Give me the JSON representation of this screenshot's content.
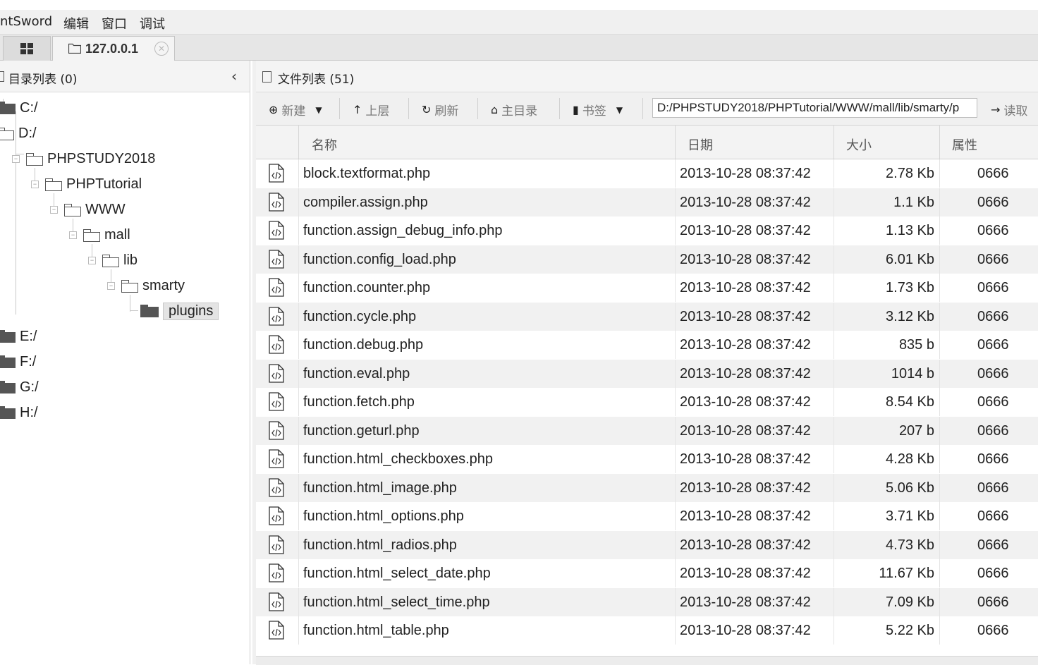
{
  "menubar": {
    "app": "ntSword",
    "edit": "编辑",
    "window": "窗口",
    "debug": "调试"
  },
  "tabs": {
    "host": "127.0.0.1"
  },
  "left": {
    "title": "目录列表 (0)",
    "tree": [
      {
        "label": "C:/"
      },
      {
        "label": "D:/"
      },
      {
        "label": "PHPSTUDY2018"
      },
      {
        "label": "PHPTutorial"
      },
      {
        "label": "WWW"
      },
      {
        "label": "mall"
      },
      {
        "label": "lib"
      },
      {
        "label": "smarty"
      },
      {
        "label": "plugins"
      },
      {
        "label": "E:/"
      },
      {
        "label": "F:/"
      },
      {
        "label": "G:/"
      },
      {
        "label": "H:/"
      }
    ]
  },
  "right": {
    "title": "文件列表 (51)",
    "toolbar": {
      "new": "新建",
      "up": "上层",
      "refresh": "刷新",
      "home": "主目录",
      "bookmark": "书签",
      "read": "读取"
    },
    "path": "D:/PHPSTUDY2018/PHPTutorial/WWW/mall/lib/smarty/p",
    "columns": {
      "name": "名称",
      "date": "日期",
      "size": "大小",
      "attr": "属性"
    },
    "files": [
      {
        "name": "block.textformat.php",
        "date": "2013-10-28 08:37:42",
        "size": "2.78 Kb",
        "attr": "0666"
      },
      {
        "name": "compiler.assign.php",
        "date": "2013-10-28 08:37:42",
        "size": "1.1 Kb",
        "attr": "0666"
      },
      {
        "name": "function.assign_debug_info.php",
        "date": "2013-10-28 08:37:42",
        "size": "1.13 Kb",
        "attr": "0666"
      },
      {
        "name": "function.config_load.php",
        "date": "2013-10-28 08:37:42",
        "size": "6.01 Kb",
        "attr": "0666"
      },
      {
        "name": "function.counter.php",
        "date": "2013-10-28 08:37:42",
        "size": "1.73 Kb",
        "attr": "0666"
      },
      {
        "name": "function.cycle.php",
        "date": "2013-10-28 08:37:42",
        "size": "3.12 Kb",
        "attr": "0666"
      },
      {
        "name": "function.debug.php",
        "date": "2013-10-28 08:37:42",
        "size": "835 b",
        "attr": "0666"
      },
      {
        "name": "function.eval.php",
        "date": "2013-10-28 08:37:42",
        "size": "1014 b",
        "attr": "0666"
      },
      {
        "name": "function.fetch.php",
        "date": "2013-10-28 08:37:42",
        "size": "8.54 Kb",
        "attr": "0666"
      },
      {
        "name": "function.geturl.php",
        "date": "2013-10-28 08:37:42",
        "size": "207 b",
        "attr": "0666"
      },
      {
        "name": "function.html_checkboxes.php",
        "date": "2013-10-28 08:37:42",
        "size": "4.28 Kb",
        "attr": "0666"
      },
      {
        "name": "function.html_image.php",
        "date": "2013-10-28 08:37:42",
        "size": "5.06 Kb",
        "attr": "0666"
      },
      {
        "name": "function.html_options.php",
        "date": "2013-10-28 08:37:42",
        "size": "3.71 Kb",
        "attr": "0666"
      },
      {
        "name": "function.html_radios.php",
        "date": "2013-10-28 08:37:42",
        "size": "4.73 Kb",
        "attr": "0666"
      },
      {
        "name": "function.html_select_date.php",
        "date": "2013-10-28 08:37:42",
        "size": "11.67 Kb",
        "attr": "0666"
      },
      {
        "name": "function.html_select_time.php",
        "date": "2013-10-28 08:37:42",
        "size": "7.09 Kb",
        "attr": "0666"
      },
      {
        "name": "function.html_table.php",
        "date": "2013-10-28 08:37:42",
        "size": "5.22 Kb",
        "attr": "0666"
      }
    ]
  },
  "icons": {
    "tab_grid": "grid-icon",
    "tab_folder": "folder-icon",
    "tab_close": "close-icon",
    "collapse": "chevron-left-icon",
    "new": "plus-circle-icon",
    "up": "arrow-up-icon",
    "refresh": "refresh-icon",
    "home": "home-icon",
    "bookmark": "bookmark-icon",
    "read": "arrow-right-icon",
    "file": "code-file-icon"
  },
  "colors": {
    "selected_bg": "#e4e4e4",
    "row_alt": "#f1f1f1",
    "folder": "#555555"
  }
}
